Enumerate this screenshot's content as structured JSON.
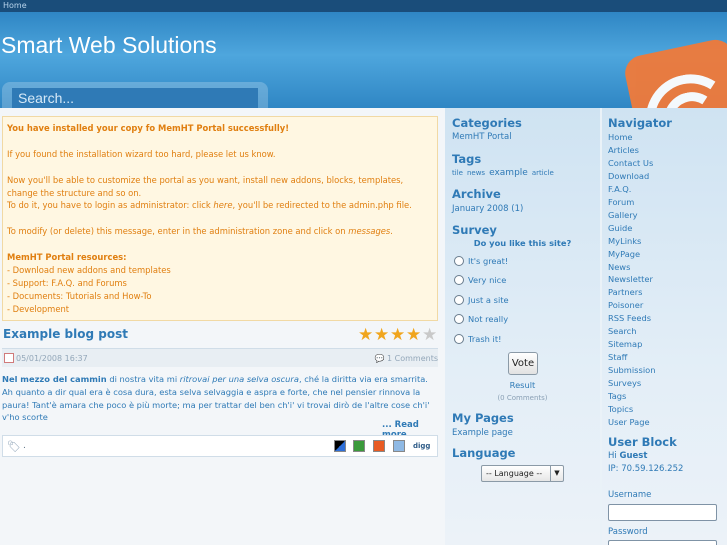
{
  "topbar": {
    "home": "Home"
  },
  "header": {
    "site_title": "Smart Web Solutions",
    "search_placeholder": "Search..."
  },
  "notice": {
    "line1": "You have installed your copy fo MemHT Portal successfully!",
    "line2": "If you found the installation wizard too hard, please let us know.",
    "line3": "Now you'll be able to customize the portal as you want, install new addons, blocks, templates, change the structure and so on.",
    "line4a": "To do it, you have to login as administrator: click ",
    "line4_here": "here",
    "line4b": ", you'll be redirected to the admin.php file.",
    "line5a": "To modify (or delete) this message, enter in the administration zone and click on ",
    "line5_messages": "messages",
    "line5b": ".",
    "res_title": "MemHT Portal resources:",
    "resources": [
      "- Download new addons and templates",
      "- Support: F.A.Q. and Forums",
      "- Documents: Tutorials and How-To",
      "- Development"
    ]
  },
  "post": {
    "title": "Example blog post",
    "rating": 4,
    "rating_max": 5,
    "date": "05/01/2008 16:37",
    "comments": "1 Comments",
    "body_bold": "Nel mezzo del cammin",
    "body_1": " di nostra vita mi ",
    "body_italic": "ritrovai per una selva oscura",
    "body_2": ", ché la diritta via era smarrita. Ah quanto a dir qual era è cosa dura, esta selva selvaggia e aspra e forte, che nel pensier rinnova la paura! Tant'è amara che poco è più morte; ma per trattar del ben ch'i' vi trovai dirò de l'altre cose ch'i' v'ho scorte",
    "read_more": "... Read more",
    "tag_dot": ".",
    "digg": "digg"
  },
  "categories": {
    "title": "Categories",
    "items": [
      "MemHT Portal"
    ]
  },
  "tags": {
    "title": "Tags",
    "items": [
      "tile",
      "news",
      "example",
      "article"
    ]
  },
  "archive": {
    "title": "Archive",
    "items": [
      "January 2008 (1)"
    ]
  },
  "survey": {
    "title": "Survey",
    "question": "Do you like this site?",
    "options": [
      "It's great!",
      "Very nice",
      "Just a site",
      "Not really",
      "Trash it!"
    ],
    "vote": "Vote",
    "result": "Result",
    "comments": "(0 Comments)"
  },
  "mypages": {
    "title": "My Pages",
    "items": [
      "Example page"
    ]
  },
  "language": {
    "title": "Language",
    "selected": "-- Language --"
  },
  "navigator": {
    "title": "Navigator",
    "items": [
      "Home",
      "Articles",
      "Contact Us",
      "Download",
      "F.A.Q.",
      "Forum",
      "Gallery",
      "Guide",
      "MyLinks",
      "MyPage",
      "News",
      "Newsletter",
      "Partners",
      "Poisoner",
      "RSS Feeds",
      "Search",
      "Sitemap",
      "Staff",
      "Submission",
      "Surveys",
      "Tags",
      "Topics",
      "User Page"
    ]
  },
  "userblock": {
    "title": "User Block",
    "hi": "Hi ",
    "guest": "Guest",
    "ip": "IP: 70.59.126.252",
    "username_label": "Username",
    "password_label": "Password"
  },
  "colors": {
    "link": "#2f7ab6",
    "notice": "#e07f10",
    "header": "#2f86c4",
    "rss": "#f07a3a"
  }
}
